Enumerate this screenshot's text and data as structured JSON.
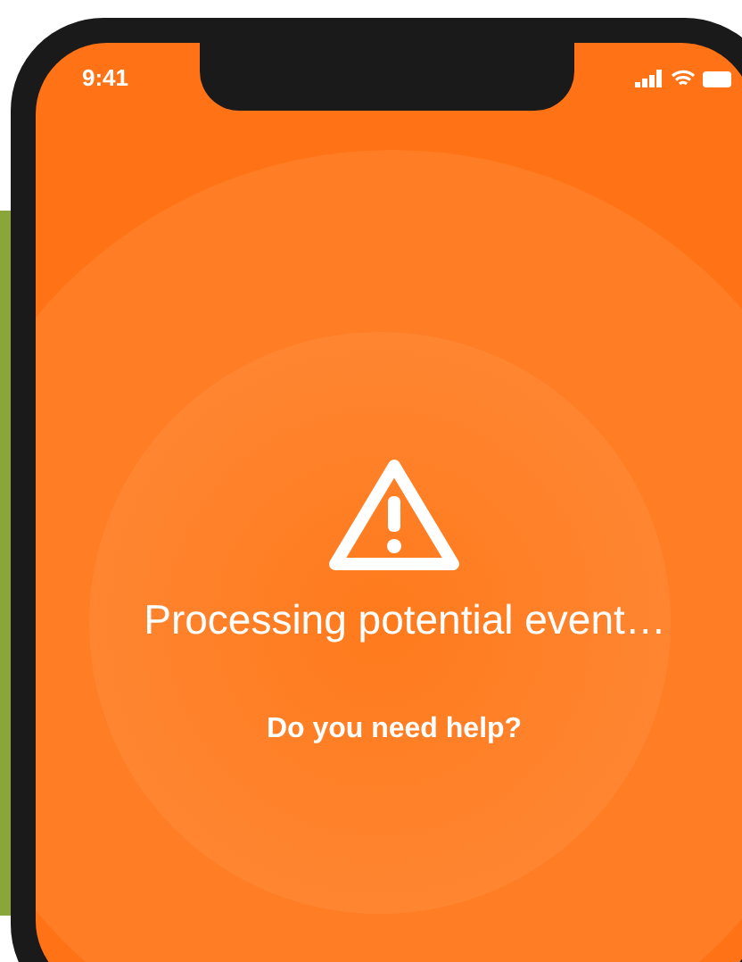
{
  "status_bar": {
    "time": "9:41"
  },
  "alert": {
    "message": "Processing potential event…",
    "prompt": "Do you need help?"
  }
}
